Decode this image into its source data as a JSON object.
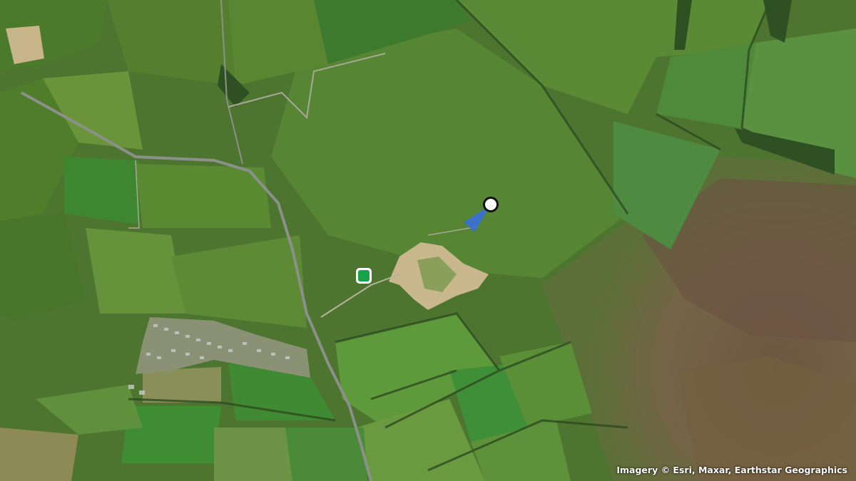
{
  "map": {
    "attribution": "Imagery © Esri, Maxar, Earthstar Geographics",
    "colors": {
      "field_green": "#4f7a2c",
      "field_light": "#6b9a3a",
      "moorland": "#7a6a45",
      "heather": "#6e5540",
      "road": "#8a8f8a",
      "quarry": "#c9b88e",
      "marker_pin": "#16a34a",
      "view_cone": "#3a6fd8"
    },
    "markers": [
      {
        "name": "current-location",
        "icon": "location-dot-icon"
      },
      {
        "name": "destination",
        "icon": "square-pin-icon"
      }
    ]
  }
}
